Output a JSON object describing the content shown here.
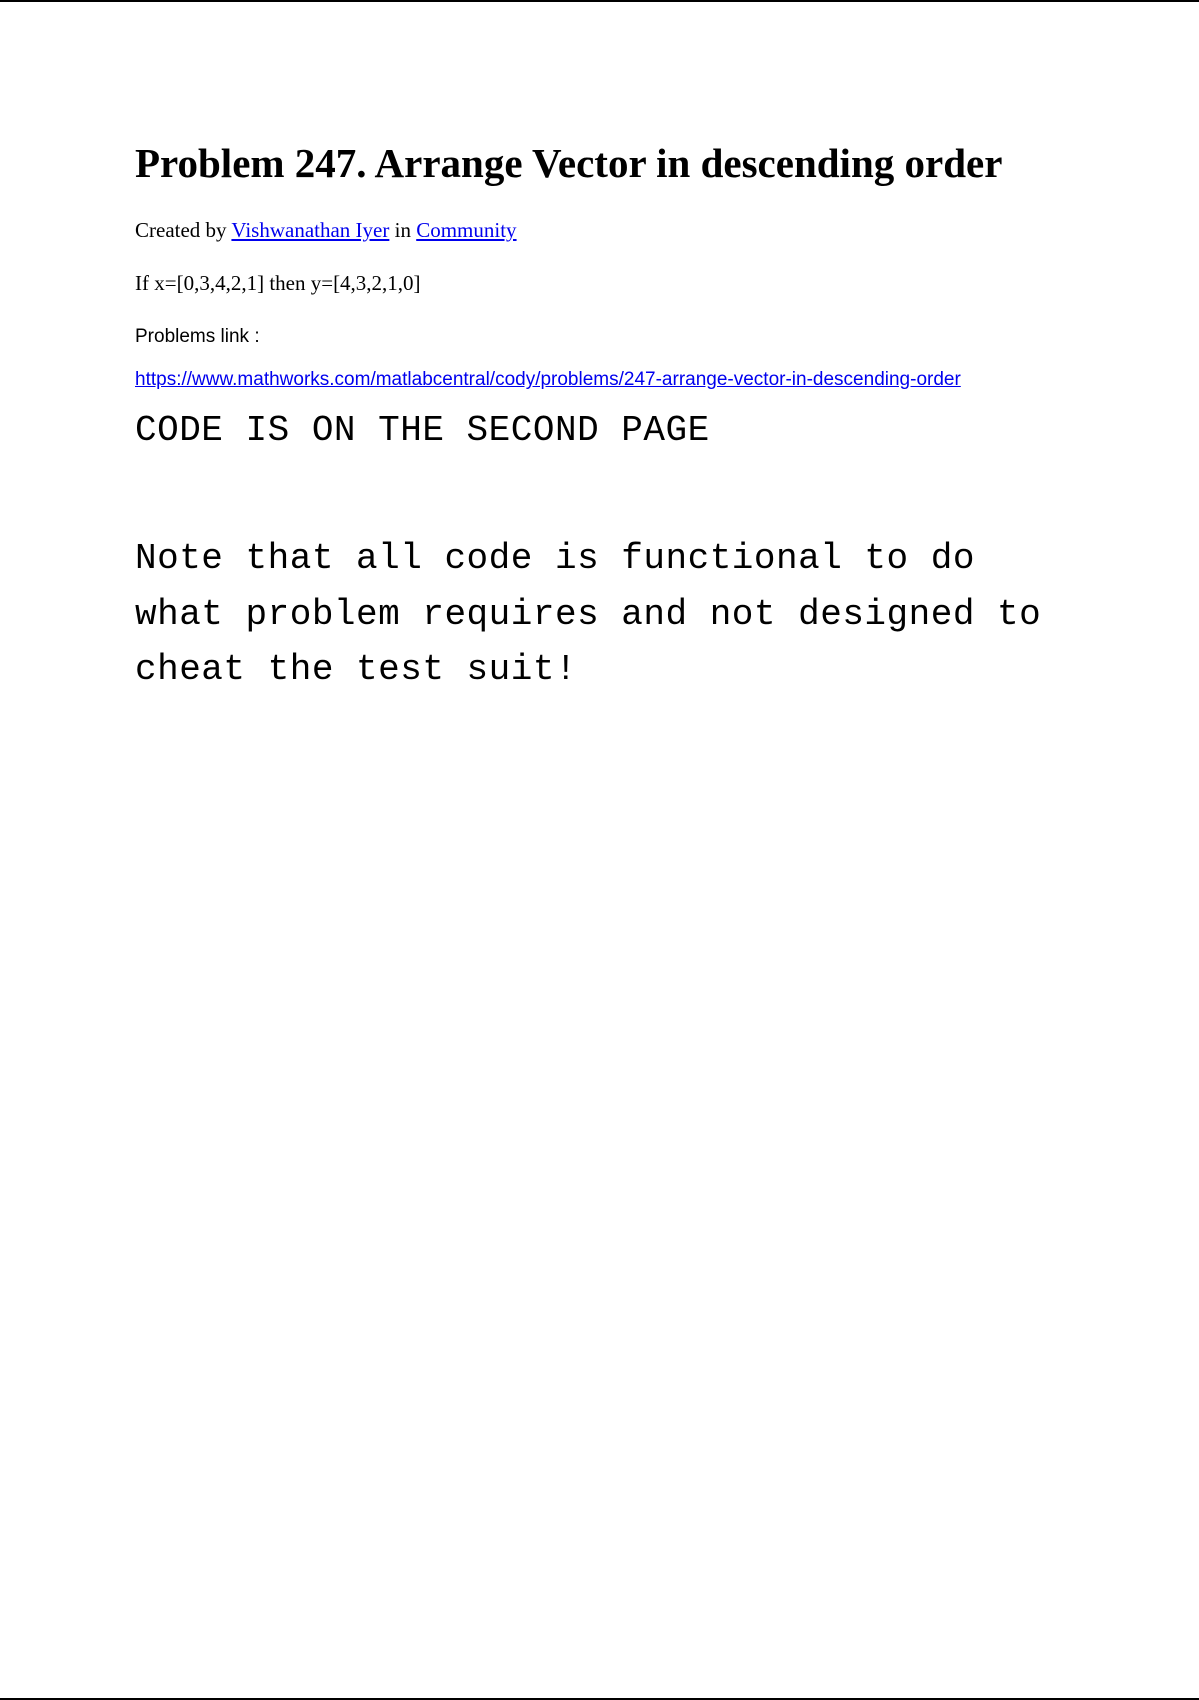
{
  "title": "Problem 247. Arrange Vector in descending order",
  "byline": {
    "prefix": "Created by ",
    "author": "Vishwanathan Iyer",
    "middle": " in ",
    "category": "Community"
  },
  "description": "If x=[0,3,4,2,1] then y=[4,3,2,1,0]",
  "problemsLinkLabel": "Problems  link :",
  "urlLink": "https://www.mathworks.com/matlabcentral/cody/problems/247-arrange-vector-in-descending-order",
  "codeNotice": "CODE IS ON THE SECOND PAGE",
  "noteText": "Note that all code is functional to do what problem requires and not designed to cheat the test suit!"
}
